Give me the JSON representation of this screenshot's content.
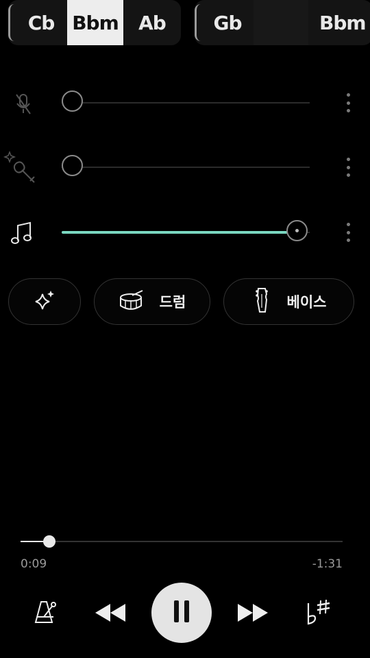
{
  "chords": {
    "group1": [
      "Cb",
      "Bbm",
      "Ab"
    ],
    "group1_selected": "Bbm",
    "group2": [
      "Gb",
      "",
      "Bbm"
    ]
  },
  "tracks": [
    {
      "icon": "mic-muted-icon",
      "level": 0.0
    },
    {
      "icon": "magic-instrument-icon",
      "level": 0.0
    },
    {
      "icon": "music-note-icon",
      "level": 1.0
    }
  ],
  "accent_color": "#7ad7c0",
  "buttons": {
    "sparkle_icon": "sparkle-icon",
    "drum_label": "드럼",
    "bass_label": "베이스"
  },
  "playback": {
    "elapsed": "0:09",
    "remaining": "-1:31",
    "progress": 0.09
  },
  "transport": {
    "metronome_icon": "metronome-icon",
    "rewind_icon": "rewind-icon",
    "pause_icon": "pause-icon",
    "forward_icon": "fast-forward-icon",
    "key_icon": "flat-sharp-icon"
  }
}
